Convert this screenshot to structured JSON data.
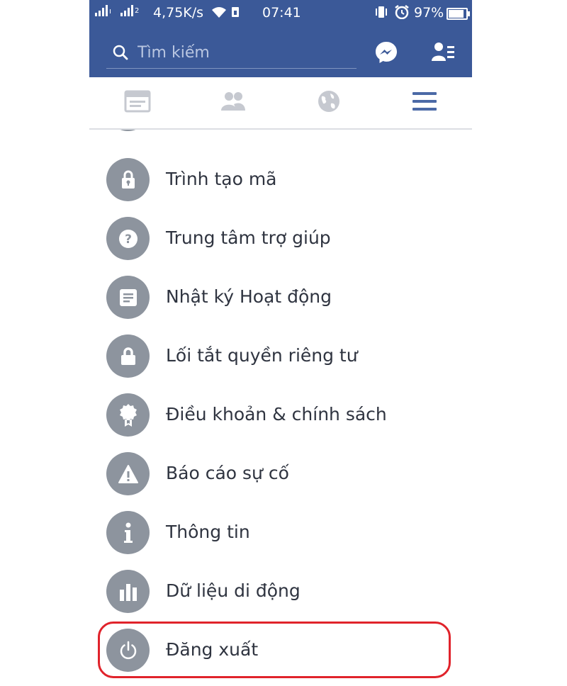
{
  "status_bar": {
    "network_speed": "4,75K/s",
    "sim_badge": "2",
    "time": "07:41",
    "battery": "97%",
    "battery_fraction": 0.97
  },
  "header": {
    "search_placeholder": "Tìm kiếm",
    "icons": [
      "search-icon",
      "messenger-icon",
      "friend-requests-icon"
    ]
  },
  "tabs": [
    {
      "name": "news-feed",
      "icon": "news-feed-icon"
    },
    {
      "name": "friends",
      "icon": "friends-icon"
    },
    {
      "name": "notifications",
      "icon": "globe-icon"
    },
    {
      "name": "menu",
      "icon": "hamburger-menu-icon",
      "active": true
    }
  ],
  "menu": {
    "items": [
      {
        "label": "Trình tạo mã",
        "icon": "lock-icon"
      },
      {
        "label": "Trung tâm trợ giúp",
        "icon": "question-icon"
      },
      {
        "label": "Nhật ký Hoạt động",
        "icon": "activity-log-icon"
      },
      {
        "label": "Lối tắt quyền riêng tư",
        "icon": "padlock-icon"
      },
      {
        "label": "Điều khoản & chính sách",
        "icon": "badge-icon"
      },
      {
        "label": "Báo cáo sự cố",
        "icon": "warning-icon"
      },
      {
        "label": "Thông tin",
        "icon": "info-icon"
      },
      {
        "label": "Dữ liệu di động",
        "icon": "bar-chart-icon"
      },
      {
        "label": "Đăng xuất",
        "icon": "power-icon"
      }
    ]
  },
  "colors": {
    "brand": "#3b5998",
    "menu_icon_bg": "#8d949e",
    "tab_inactive": "#c6c9d0",
    "tab_active": "#4b69a6",
    "highlight": "#e0232b"
  }
}
